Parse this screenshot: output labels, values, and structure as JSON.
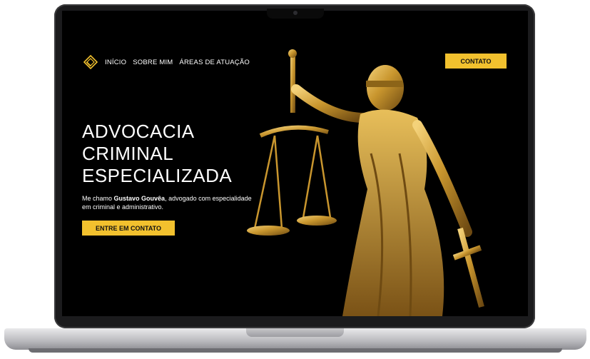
{
  "nav": {
    "items": [
      {
        "label": "INÍCIO"
      },
      {
        "label": "SOBRE MIM"
      },
      {
        "label": "ÁREAS DE ATUAÇÃO"
      }
    ],
    "contact_label": "CONTATO"
  },
  "hero": {
    "headline_lines": [
      "ADVOCACIA",
      "CRIMINAL",
      "ESPECIALIZADA"
    ],
    "subtitle_prefix": "Me chamo ",
    "subtitle_name": "Gustavo Gouvêa",
    "subtitle_suffix": ", advogado com especialidade em criminal e administrativo.",
    "cta_label": "ENTRE EM CONTATO"
  },
  "colors": {
    "accent": "#f2c12e",
    "background": "#000000",
    "text": "#ffffff",
    "gold": "#c9962e"
  },
  "icons": {
    "logo": "gold-diamond-logo-icon",
    "image": "lady-justice-statue"
  }
}
